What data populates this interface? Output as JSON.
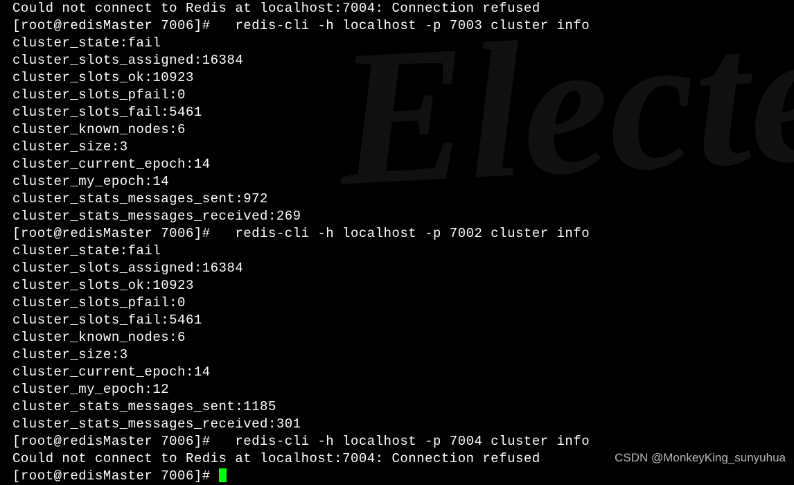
{
  "lines": {
    "error1": "Could not connect to Redis at localhost:7004: Connection refused",
    "prompt1": "[root@redisMaster 7006]#   redis-cli -h localhost -p 7003 cluster info",
    "block1": {
      "l1": "cluster_state:fail",
      "l2": "cluster_slots_assigned:16384",
      "l3": "cluster_slots_ok:10923",
      "l4": "cluster_slots_pfail:0",
      "l5": "cluster_slots_fail:5461",
      "l6": "cluster_known_nodes:6",
      "l7": "cluster_size:3",
      "l8": "cluster_current_epoch:14",
      "l9": "cluster_my_epoch:14",
      "l10": "cluster_stats_messages_sent:972",
      "l11": "cluster_stats_messages_received:269"
    },
    "prompt2": "[root@redisMaster 7006]#   redis-cli -h localhost -p 7002 cluster info",
    "block2": {
      "l1": "cluster_state:fail",
      "l2": "cluster_slots_assigned:16384",
      "l3": "cluster_slots_ok:10923",
      "l4": "cluster_slots_pfail:0",
      "l5": "cluster_slots_fail:5461",
      "l6": "cluster_known_nodes:6",
      "l7": "cluster_size:3",
      "l8": "cluster_current_epoch:14",
      "l9": "cluster_my_epoch:12",
      "l10": "cluster_stats_messages_sent:1185",
      "l11": "cluster_stats_messages_received:301"
    },
    "prompt3": "[root@redisMaster 7006]#   redis-cli -h localhost -p 7004 cluster info",
    "error2": "Could not connect to Redis at localhost:7004: Connection refused",
    "prompt4_partial": "[root@redisMaster 7006]# "
  },
  "watermark": "CSDN @MonkeyKing_sunyuhua",
  "bg_text": "Electe"
}
